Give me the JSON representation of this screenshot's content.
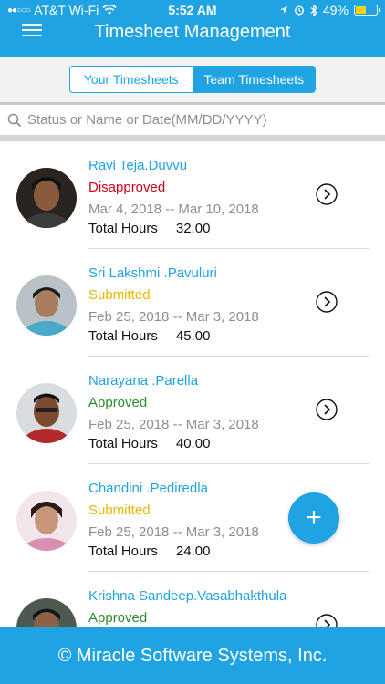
{
  "status_bar": {
    "carrier": "AT&T Wi-Fi",
    "time": "5:52 AM",
    "battery": "49%",
    "battery_level": 0.49
  },
  "header": {
    "title": "Timesheet Management",
    "menu_icon": "hamburger-menu-icon"
  },
  "tabs": [
    {
      "label": "Your Timesheets",
      "active": false
    },
    {
      "label": "Team Timesheets",
      "active": true
    }
  ],
  "search": {
    "placeholder": "Status or Name or Date(MM/DD/YYYY)",
    "value": ""
  },
  "colors": {
    "accent": "#1fa3e2",
    "disapproved": "#d0021b",
    "submitted": "#e8b800",
    "approved": "#2e8b2e"
  },
  "timesheets": [
    {
      "name": "Ravi Teja.Duvvu",
      "status": "Disapproved",
      "status_key": "disapproved",
      "dates": "Mar 4, 2018 -- Mar 10, 2018",
      "hours_label": "Total Hours",
      "hours": "32.00"
    },
    {
      "name": "Sri Lakshmi .Pavuluri",
      "status": "Submitted",
      "status_key": "submitted",
      "dates": "Feb 25, 2018 -- Mar 3, 2018",
      "hours_label": "Total Hours",
      "hours": "45.00"
    },
    {
      "name": "Narayana .Parella",
      "status": "Approved",
      "status_key": "approved",
      "dates": "Feb 25, 2018 -- Mar 3, 2018",
      "hours_label": "Total Hours",
      "hours": "40.00"
    },
    {
      "name": "Chandini .Pediredla",
      "status": "Submitted",
      "status_key": "submitted",
      "dates": "Feb 25, 2018 -- Mar 3, 2018",
      "hours_label": "Total Hours",
      "hours": "24.00"
    },
    {
      "name": "Krishna Sandeep.Vasabhakthula",
      "status": "Approved",
      "status_key": "approved",
      "dates": "",
      "hours_label": "",
      "hours": ""
    }
  ],
  "fab": {
    "label": "+",
    "icon": "plus-icon"
  },
  "footer": {
    "text": "© Miracle Software Systems, Inc."
  }
}
